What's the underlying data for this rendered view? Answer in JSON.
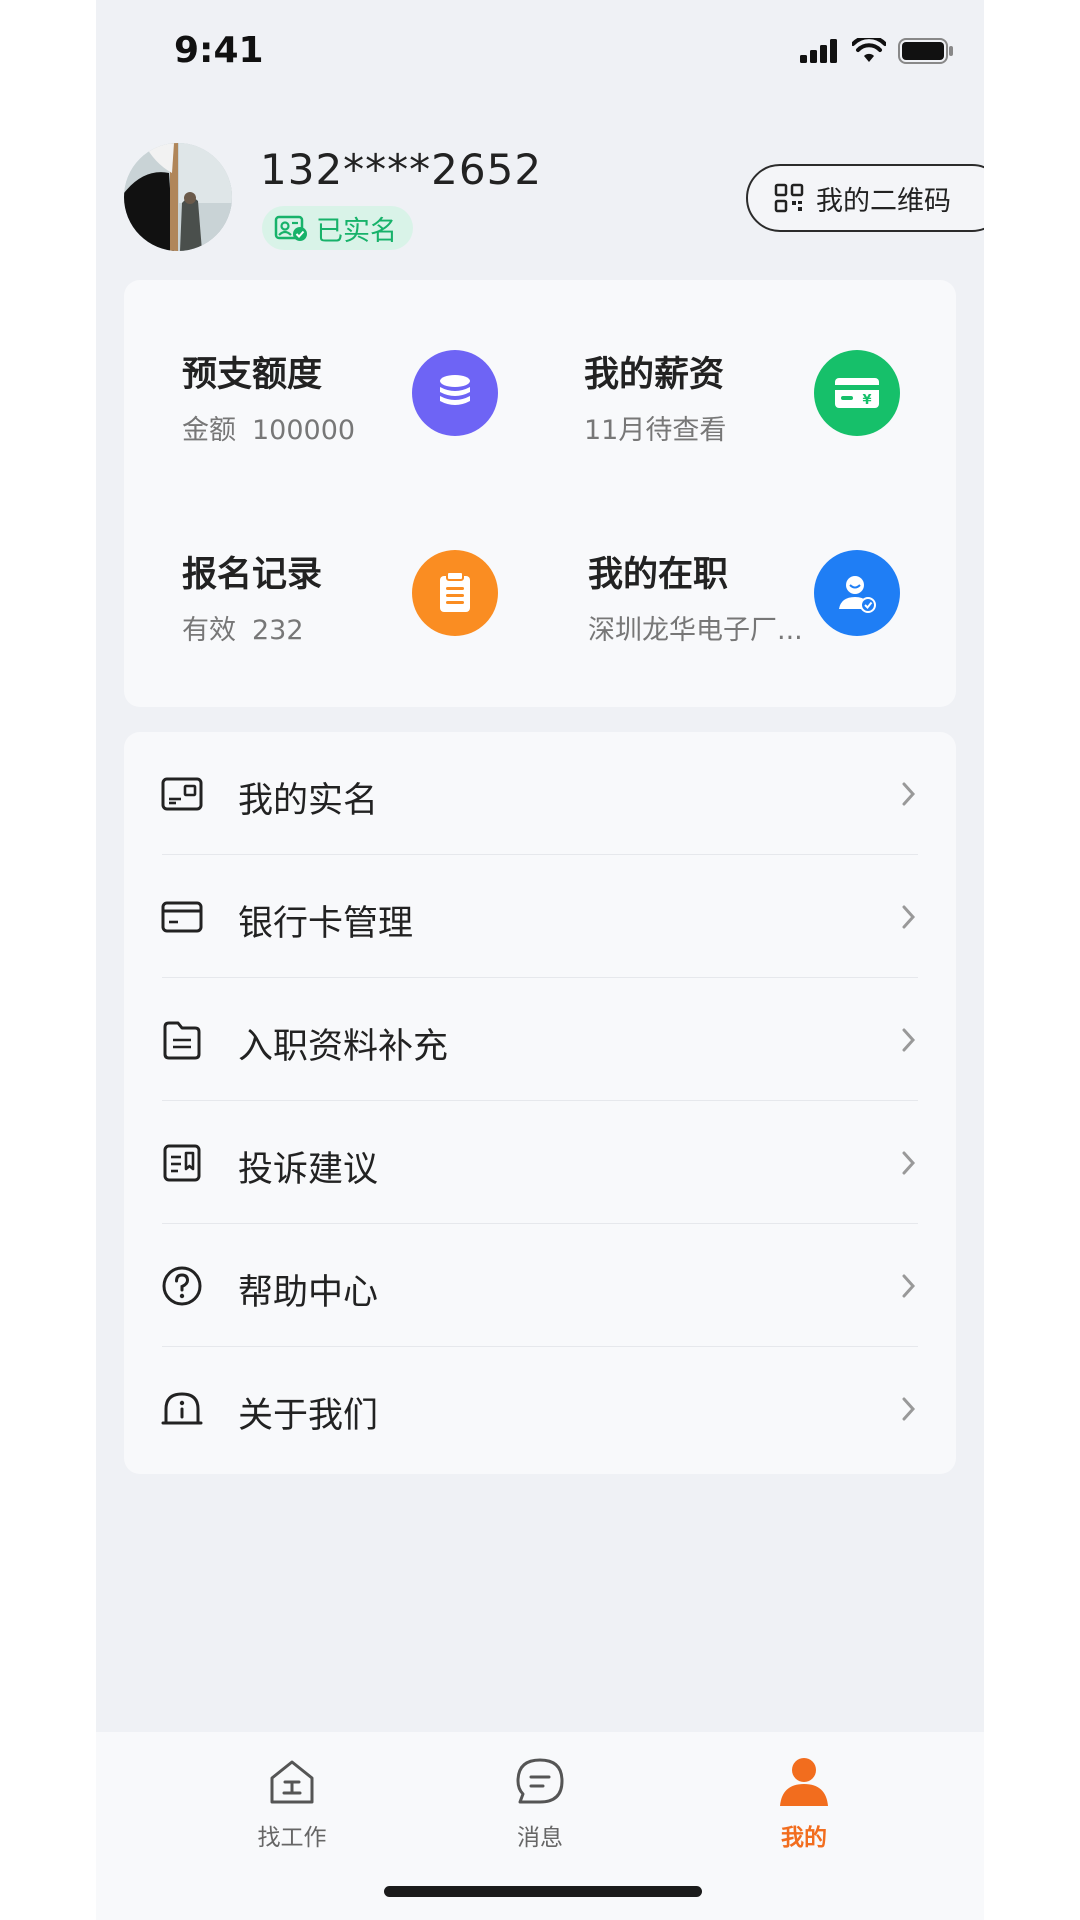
{
  "status_bar": {
    "time": "9:41"
  },
  "profile": {
    "phone": "132****2652",
    "verified_label": "已实名",
    "qr_label": "我的二维码"
  },
  "stats": [
    {
      "title": "预支额度",
      "sub_key": "金额",
      "sub_value": "100000",
      "icon": "coins-icon",
      "color": "#6e64f5"
    },
    {
      "title": "我的薪资",
      "sub_key": "11月待查看",
      "sub_value": "",
      "icon": "salary-card-icon",
      "color": "#16c06a"
    },
    {
      "title": "报名记录",
      "sub_key": "有效",
      "sub_value": "232",
      "icon": "clipboard-icon",
      "color": "#fa8d22"
    },
    {
      "title": "我的在职",
      "sub_key": "深圳龙华电子厂...",
      "sub_value": "",
      "icon": "employee-icon",
      "color": "#1f7ef5"
    }
  ],
  "menu": [
    {
      "label": "我的实名",
      "icon": "id-card-icon"
    },
    {
      "label": "银行卡管理",
      "icon": "bank-card-icon"
    },
    {
      "label": "入职资料补充",
      "icon": "folder-icon"
    },
    {
      "label": "投诉建议",
      "icon": "feedback-icon"
    },
    {
      "label": "帮助中心",
      "icon": "help-icon"
    },
    {
      "label": "关于我们",
      "icon": "about-icon"
    }
  ],
  "tabs": [
    {
      "label": "找工作",
      "icon": "home-work-icon",
      "active": false
    },
    {
      "label": "消息",
      "icon": "message-icon",
      "active": false
    },
    {
      "label": "我的",
      "icon": "profile-icon",
      "active": true
    }
  ],
  "colors": {
    "accent": "#f26d1e",
    "verified": "#17b26a",
    "background": "#eff1f5"
  }
}
